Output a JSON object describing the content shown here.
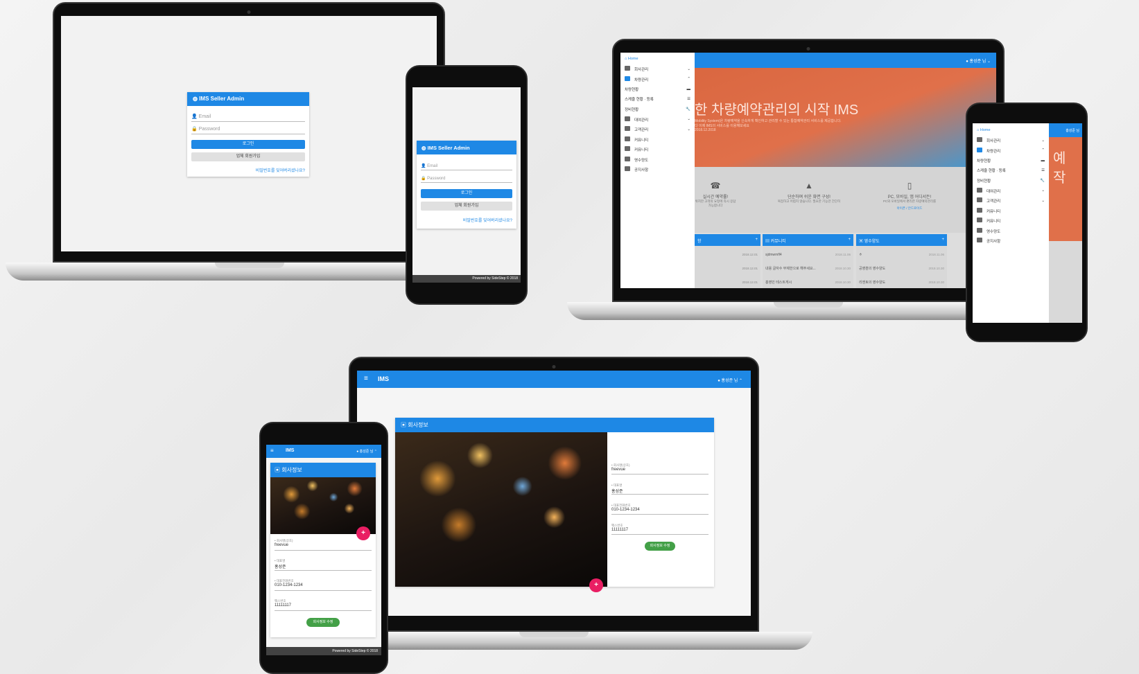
{
  "login": {
    "title": "IMS Seller Admin",
    "email_placeholder": "Email",
    "password_placeholder": "Password",
    "login_button": "로그인",
    "signup_button": "업체 회원가입",
    "forgot_link": "비밀번호를 잊어버리셨나요?",
    "footer": "Powered by SideStep © 2018"
  },
  "app": {
    "brand": "IMS",
    "user": "홍성준 님"
  },
  "menu": {
    "home": "Home",
    "items": [
      "회사관리",
      "차량관리",
      "차량현황",
      "스케줄 현황 · 등록",
      "정비현황",
      "대여관리",
      "고객관리",
      "커뮤니티",
      "커뮤니티",
      "영수양도",
      "공지사항"
    ]
  },
  "hero": {
    "title": "한 차량예약관리의 시작 IMS",
    "subtitle": "Mobility System)은 차량예약을 신속하게 확인하고 관리할 수 있는 통합예약관리 서비스를 제공합니다.",
    "subtitle2": "다 이제 IMS의 서비스를 이용해보세요",
    "date": "2018.12.2018"
  },
  "features": [
    {
      "icon": "phone-icon",
      "title": "실시간 예약률!",
      "desc": "위치한 고객의 요청에 즉시 응답 가능합니다"
    },
    {
      "icon": "shapes-icon",
      "title": "단순하며 쉬운 화면 구성!",
      "desc": "복잡하고 어렵지 않습니다. 필요한 기능만 간단히"
    },
    {
      "icon": "mobile-icon",
      "title": "PC, 모바일, 앱 어디서든!",
      "desc": "PC와 모바일에서 편리한 차량예약관리를",
      "link": "아이폰 / 안드로이드"
    }
  ],
  "boards": [
    {
      "title": "항",
      "rows": [
        {
          "text": "",
          "date": "2018.12.01"
        },
        {
          "text": "",
          "date": "2018.12.01"
        },
        {
          "text": "",
          "date": "2018.12.01"
        }
      ]
    },
    {
      "title": "커뮤니티",
      "rows": [
        {
          "text": "sjdmwmfl4",
          "date": "2018.11.06"
        },
        {
          "text": "내용 글자수 무제한으로 해주세요...",
          "date": "2018.10.30"
        },
        {
          "text": "홍영민 테스트게시",
          "date": "2018.10.30"
        }
      ]
    },
    {
      "title": "영수양도",
      "rows": [
        {
          "text": "ㅎ",
          "date": "2018.11.06"
        },
        {
          "text": "공영휸의 영수양도",
          "date": "2018.10.30"
        },
        {
          "text": "리엔토의 영수양도",
          "date": "2018.10.30"
        }
      ]
    }
  ],
  "company": {
    "title": "회사정보",
    "fields": [
      {
        "label": "• 회사명(상호)",
        "value": "freevue"
      },
      {
        "label": "• 대표명",
        "value": "홍성준"
      },
      {
        "label": "• 대표전화번호",
        "value": "010-1234-1234"
      },
      {
        "label": "팩스번호",
        "value": "11111117"
      }
    ],
    "save_button": "회사정보 수정",
    "fab": "+"
  },
  "side_hero": {
    "line1": "예",
    "line2": "작"
  },
  "colors": {
    "primary": "#1e88e5",
    "accent": "#e91e63",
    "success": "#43a047"
  }
}
